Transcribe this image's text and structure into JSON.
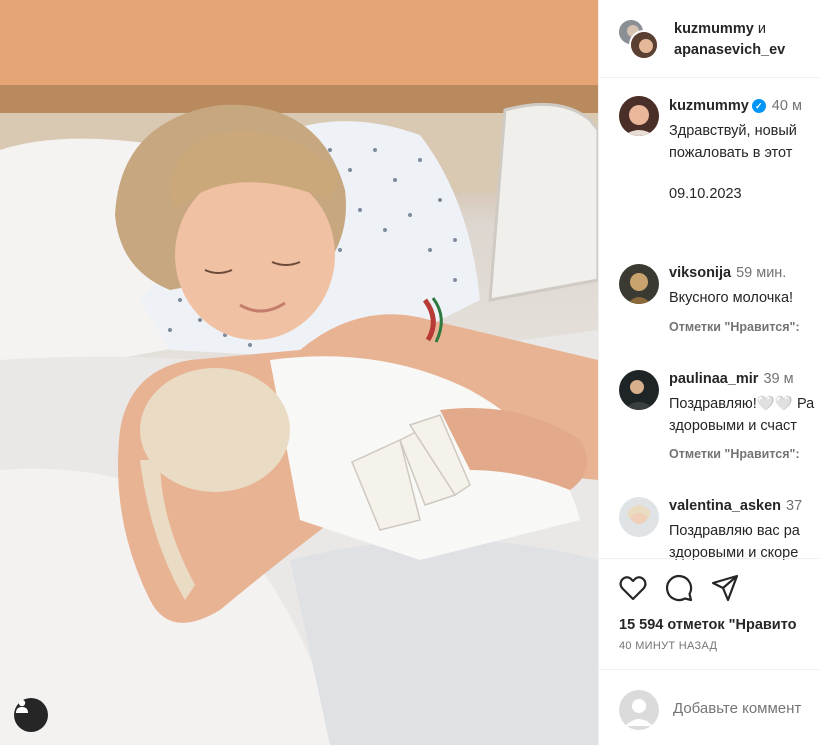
{
  "header": {
    "user1": "kuzmummy",
    "conjunction": "и",
    "user2": "apanasevich_ev"
  },
  "caption": {
    "username": "kuzmummy",
    "verified": "✓",
    "time": "40 м",
    "text_line1": "Здравствуй, новый",
    "text_line2": "пожаловать в этот",
    "date": "09.10.2023"
  },
  "comments": [
    {
      "username": "viksonija",
      "time": "59 мин.",
      "text_line1": "Вкусного молочка!",
      "text_line2": "",
      "likes_label": "Отметки \"Нравится\":"
    },
    {
      "username": "paulinaa_mir",
      "time": "39 м",
      "text_line1": "Поздравляю!🤍🤍 Ра",
      "text_line2": "здоровыми и счаст",
      "likes_label": "Отметки \"Нравится\":"
    },
    {
      "username": "valentina_asken",
      "time": "37",
      "text_line1": "Поздравляю вас ра",
      "text_line2": "здоровыми и скоре",
      "likes_label": ""
    }
  ],
  "actions": {
    "like_icon": "heart-icon",
    "comment_icon": "comment-icon",
    "share_icon": "share-icon"
  },
  "likes_text": "15 594 отметок \"Нравито",
  "time_ago": "40 МИНУТ НАЗАД",
  "add_comment_placeholder": "Добавьте коммент",
  "colors": {
    "verified": "#0095f6",
    "muted": "#737373",
    "text": "#262626"
  }
}
